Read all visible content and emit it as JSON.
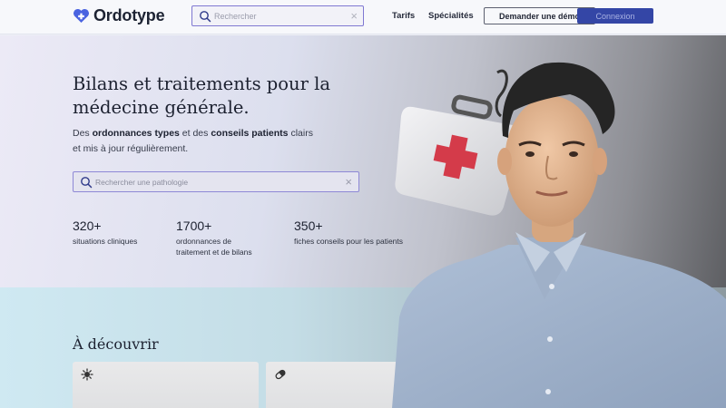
{
  "header": {
    "logo_text": "Ordotype",
    "search_placeholder": "Rechercher",
    "search_clear": "×",
    "nav": {
      "tarifs": "Tarifs",
      "specialites": "Spécialités"
    },
    "demo_button": "Demander une démo",
    "login_button": "Connexion"
  },
  "hero": {
    "title": "Bilans et traitements pour la médecine générale.",
    "desc_1": "Des ",
    "desc_bold_1": "ordonnances types",
    "desc_2": " et des ",
    "desc_bold_2": "conseils patients",
    "desc_3": " clairs et mis à jour régulièrement.",
    "search_placeholder": "Rechercher une pathologie",
    "search_clear": "×",
    "stats": [
      {
        "number": "320+",
        "label": "situations cliniques"
      },
      {
        "number": "1700+",
        "label": "ordonnances de traitement et de bilans"
      },
      {
        "number": "350+",
        "label": "fiches conseils pour les patients"
      }
    ]
  },
  "discover": {
    "title": "À découvrir",
    "cards": [
      {
        "icon": "virus-icon"
      },
      {
        "icon": "pill-icon"
      }
    ]
  },
  "colors": {
    "accent": "#3446a6",
    "search_border": "#7f78d2",
    "logo_heart": "#4a63e0",
    "medkit_cross": "#d43b4a"
  }
}
